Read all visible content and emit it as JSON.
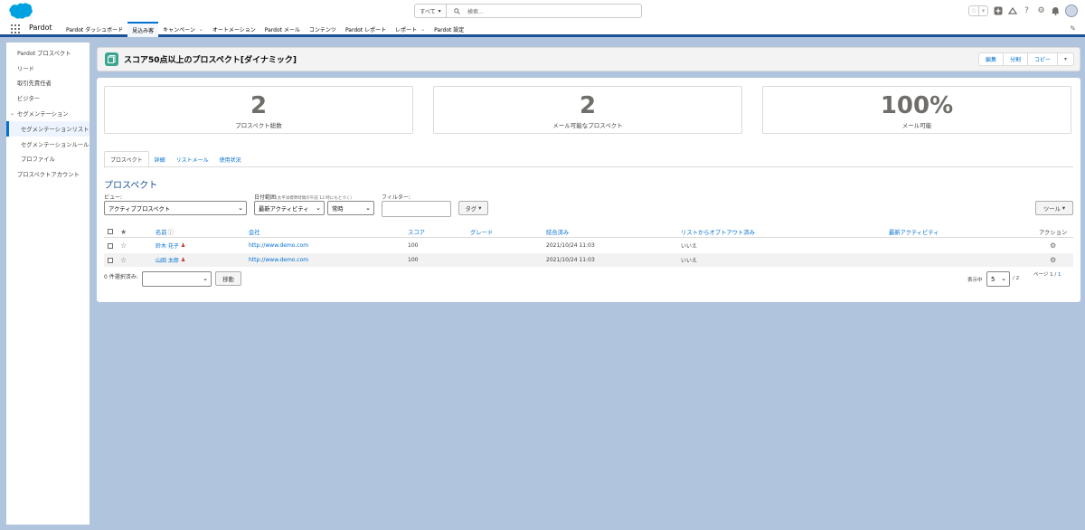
{
  "header": {
    "search_scope": "すべて",
    "search_placeholder": "検索..."
  },
  "nav": {
    "app_name": "Pardot",
    "items": [
      {
        "label": "Pardot ダッシュボード",
        "caret": false
      },
      {
        "label": "見込み客",
        "caret": false,
        "active": true
      },
      {
        "label": "キャンペーン",
        "caret": true
      },
      {
        "label": "オートメーション",
        "caret": false
      },
      {
        "label": "Pardot メール",
        "caret": false
      },
      {
        "label": "コンテンツ",
        "caret": false
      },
      {
        "label": "Pardot レポート",
        "caret": false
      },
      {
        "label": "レポート",
        "caret": true
      },
      {
        "label": "Pardot 設定",
        "caret": false
      }
    ]
  },
  "sidebar": {
    "items": [
      {
        "label": "Pardot プロスペクト"
      },
      {
        "label": "リード"
      },
      {
        "label": "取引先責任者"
      },
      {
        "label": "ビジター"
      },
      {
        "label": "セグメンテーション",
        "group": true
      },
      {
        "label": "セグメンテーションリスト",
        "sub": true,
        "active": true
      },
      {
        "label": "セグメンテーションルール",
        "sub": true
      },
      {
        "label": "プロファイル",
        "sub": true
      },
      {
        "label": "プロスペクトアカウント"
      }
    ]
  },
  "page": {
    "title": "スコア50点以上のプロスペクト[ダイナミック]",
    "buttons": {
      "edit": "編集",
      "split": "分割",
      "copy": "コピー"
    }
  },
  "metrics": [
    {
      "value": "2",
      "label": "プロスペクト総数"
    },
    {
      "value": "2",
      "label": "メール可能なプロスペクト"
    },
    {
      "value": "100%",
      "label": "メール可能"
    }
  ],
  "tabs": [
    "プロスペクト",
    "詳細",
    "リストメール",
    "使用状況"
  ],
  "section_title": "プロスペクト",
  "filters": {
    "view_label": "ビュー:",
    "view_value": "アクティブプロスペクト",
    "date_label": "日付範囲",
    "date_note": "(太平洋標準時間の午前 12 時にもとづく)",
    "date_field": "最新アクティビティ",
    "date_range": "常時",
    "filter_label": "フィルター:",
    "tag_button": "タグ",
    "tools_button": "ツール"
  },
  "table": {
    "headers": {
      "name": "名前",
      "company": "会社",
      "score": "スコア",
      "grade": "グレード",
      "synced": "結合済み",
      "opted_out": "リストからオプトアウト済み",
      "last_activity": "最新アクティビティ",
      "actions": "アクション"
    },
    "rows": [
      {
        "name": "鈴木 花子",
        "company": "http://www.demo.com",
        "score": "100",
        "grade": "",
        "synced": "2021/10/24 11:03",
        "opted_out": "いいえ",
        "last_activity": ""
      },
      {
        "name": "山田 太郎",
        "company": "http://www.demo.com",
        "score": "100",
        "grade": "",
        "synced": "2021/10/24 11:03",
        "opted_out": "いいえ",
        "last_activity": ""
      }
    ]
  },
  "footer": {
    "selected": "0 件選択済み:",
    "move_button": "移動",
    "per_page_label": "表示中",
    "per_page_value": "5",
    "per_page_total": "/ 2",
    "page_label": "ページ 1 /",
    "page_link": "1"
  },
  "colors": {
    "brand_blue": "#1b5297",
    "link": "#0070d2",
    "background": "#b0c4de",
    "list_icon": "#3ca58d"
  }
}
